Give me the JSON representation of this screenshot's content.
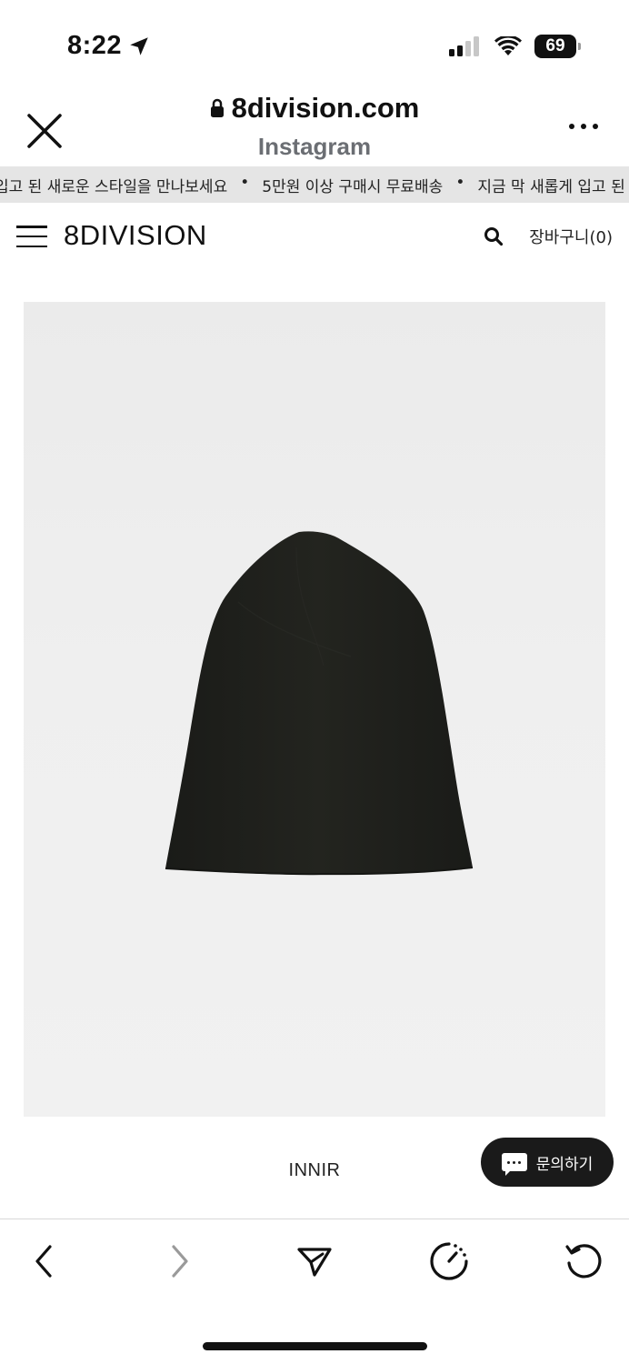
{
  "status_bar": {
    "time": "8:22",
    "battery": "69"
  },
  "browser": {
    "url": "8division.com",
    "source": "Instagram"
  },
  "marquee": {
    "items": [
      "입고 된 새로운 스타일을 만나보세요",
      "5만원 이상 구매시 무료배송",
      "지금 막 새롭게 입고 된 사"
    ],
    "separator": "•"
  },
  "site": {
    "logo": "8DIVISION",
    "cart_label": "장바구니(0)"
  },
  "product": {
    "brand": "INNIR"
  },
  "chat": {
    "label": "문의하기"
  },
  "icons": {
    "close": "close-icon",
    "lock": "lock-icon",
    "more": "more-icon",
    "menu": "hamburger-icon",
    "search": "search-icon",
    "back": "chevron-left-icon",
    "forward": "chevron-right-icon",
    "share": "send-icon",
    "timer": "timer-icon",
    "reload": "reload-icon",
    "chat": "chat-bubble-icon"
  },
  "colors": {
    "marquee_bg": "#e5e5e5",
    "chat_bg": "#1a1a1a",
    "subtitle": "#6b6e73",
    "product_bg": "#eeeeee",
    "hat": "#1c1d1a"
  }
}
